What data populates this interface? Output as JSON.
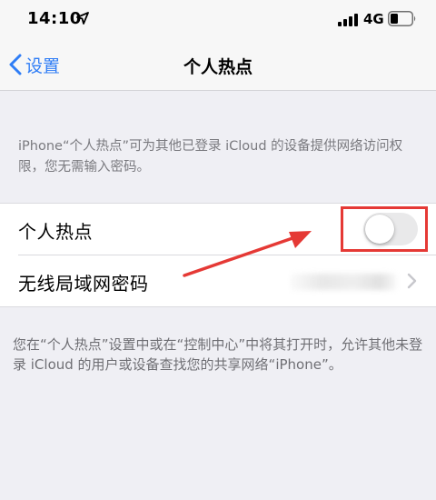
{
  "status_bar": {
    "time": "14:10",
    "network": "4G",
    "icons": [
      "location-arrow-icon",
      "signal-icon",
      "battery-icon"
    ]
  },
  "nav": {
    "back_label": "设置",
    "title": "个人热点"
  },
  "description_top": "iPhone“个人热点”可为其他已登录 iCloud 的设备提供网络访问权限，您无需输入密码。",
  "rows": [
    {
      "label": "个人热点",
      "control": "toggle",
      "enabled": false
    },
    {
      "label": "无线局域网密码",
      "control": "disclosure"
    }
  ],
  "description_bottom": "您在“个人热点”设置中或在“控制中心”中将其打开时，允许其他未登录 iCloud 的用户或设备查找您的共享网络“iPhone”。",
  "colors": {
    "accent": "#2f7df6",
    "annotation": "#e53935",
    "background": "#efeff4",
    "toggle_off": "#e9e9ea"
  }
}
